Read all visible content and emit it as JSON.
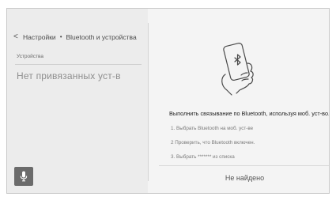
{
  "header": {
    "breadcrumb": [
      "Настройки",
      "Bluetooth и устройства"
    ],
    "separator": "•",
    "back_icon": "chevron-left-icon"
  },
  "sidebar": {
    "section_label": "Устройства",
    "empty_text": "Нет привязанных уст-в",
    "mic_icon": "microphone-icon"
  },
  "main": {
    "illustration": "phone-bluetooth-hand-icon",
    "headline": "Выполнить связывание по Bluetooth, используя моб. уст-во.",
    "steps": [
      "1. Выбрать Bluetooth на моб. уст-ве",
      "2 Проверить, что Bluetooth включен.",
      "3. Выбрать ******* из списка"
    ],
    "status_button": "Не найдено"
  },
  "colors": {
    "panel_bg": "#f2f2f2",
    "mic_button_bg": "#6b6b6b",
    "muted_text": "#8e8e8e"
  }
}
